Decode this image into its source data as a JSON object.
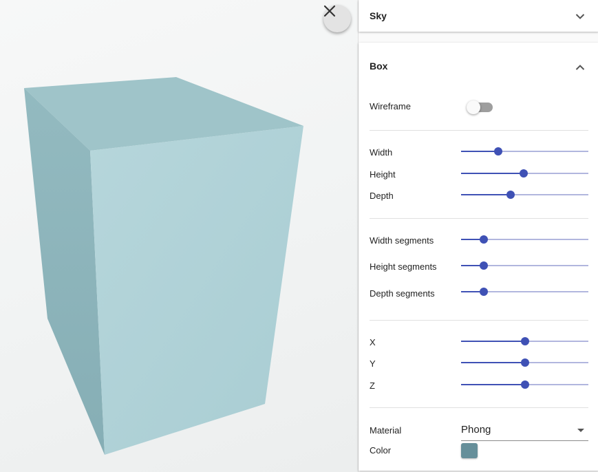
{
  "viewport": {
    "box_colors": {
      "top": "#9cc2c7",
      "left": "#8db5bc",
      "front": "#b2d3d8"
    },
    "close_icon": "close-icon"
  },
  "panel": {
    "sky": {
      "title": "Sky",
      "expanded": false,
      "chevron_icon": "chevron-down-icon"
    },
    "box": {
      "title": "Box",
      "expanded": true,
      "chevron_icon": "chevron-up-icon",
      "wireframe": {
        "label": "Wireframe",
        "on": false
      },
      "dimensions": [
        {
          "label": "Width",
          "value": 0.29
        },
        {
          "label": "Height",
          "value": 0.49
        },
        {
          "label": "Depth",
          "value": 0.39
        }
      ],
      "segments": [
        {
          "label": "Width segments",
          "value": 0.18
        },
        {
          "label": "Height segments",
          "value": 0.18
        },
        {
          "label": "Depth segments",
          "value": 0.18
        }
      ],
      "position": [
        {
          "label": "X",
          "value": 0.5
        },
        {
          "label": "Y",
          "value": 0.5
        },
        {
          "label": "Z",
          "value": 0.5
        }
      ],
      "material": {
        "label": "Material",
        "value": "Phong"
      },
      "color": {
        "label": "Color",
        "value": "#668f9a"
      }
    }
  }
}
